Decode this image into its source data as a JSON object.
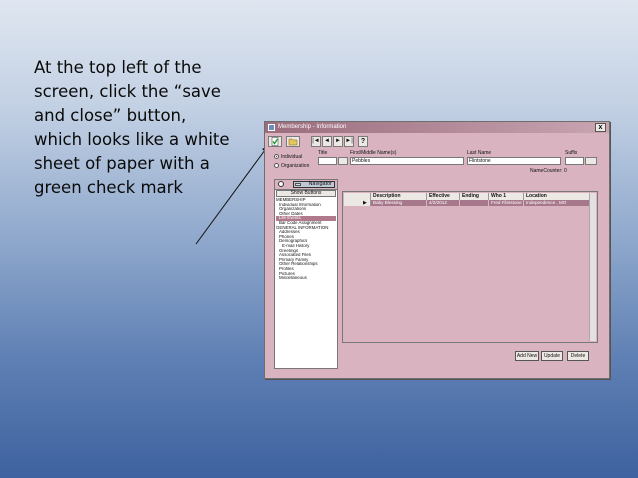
{
  "slide": {
    "instruction_lines": [
      "At the top left of the",
      "screen, click the “save",
      "and close” button,",
      "which looks like a white",
      "sheet of paper with a",
      "green check mark"
    ]
  },
  "window": {
    "title": "Membership - Information",
    "close_label": "x"
  },
  "toolbar": {
    "save_close_icon": "sheet-green-check-icon",
    "folder_icon": "folder-icon",
    "nav_labels": [
      "|◄",
      "◄",
      "►",
      "►|"
    ],
    "help_label": "?"
  },
  "form": {
    "title_label": "Title",
    "first_middle_label": "First/Middle Name(s)",
    "first_middle_value": "Pebbles",
    "last_name_label": "Last Name",
    "last_name_value": "Flintstone",
    "suffix_label": "Suffix",
    "individual_label": "Individual",
    "organization_label": "Organization",
    "namecounter_label": "NameCounter:",
    "namecounter_value": "0"
  },
  "navigator": {
    "title": "Navigator",
    "show_buttons_label": "Show Buttons",
    "items": [
      "MEMBERSHIP",
      "Individual Information",
      "Organizations",
      "Other Dates",
      "Life Events",
      "Bar Code Assignment",
      "GENERAL INFORMATION",
      "Addresses",
      "Phones",
      "Demographics",
      "E-mail History",
      "Greetings",
      "Associated Files",
      "Primary Family",
      "Other Relationships",
      "Profiles",
      "Pictures",
      "Miscellaneous"
    ]
  },
  "grid": {
    "columns": [
      "Description",
      "Effective",
      "Ending",
      "Who 1",
      "Location"
    ],
    "rows": [
      [
        "Baby Blessing",
        "4/2/2012",
        "",
        "Fred Flintstone",
        "Independence , MO"
      ]
    ]
  },
  "actions": {
    "add_new_label": "Add New",
    "update_label": "Update",
    "delete_label": "Delete"
  }
}
